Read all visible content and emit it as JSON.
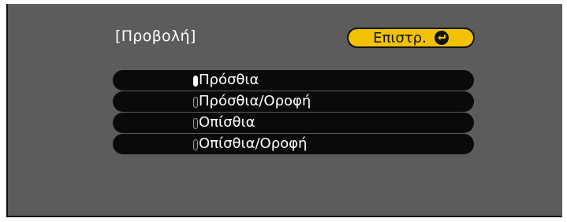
{
  "menu": {
    "title": "[Προβολή]",
    "return_label": "Επιστρ.",
    "options": [
      {
        "label": "Πρόσθια",
        "selected": true
      },
      {
        "label": "Πρόσθια/Οροφή",
        "selected": false
      },
      {
        "label": "Οπίσθια",
        "selected": false
      },
      {
        "label": "Οπίσθια/Οροφή",
        "selected": false
      }
    ]
  },
  "colors": {
    "background": "#5c5c5c",
    "option_bar": "#0a0a0a",
    "return_button": "#f2c200",
    "text": "#ffffff"
  },
  "icons": {
    "return": "enter-return-icon"
  }
}
